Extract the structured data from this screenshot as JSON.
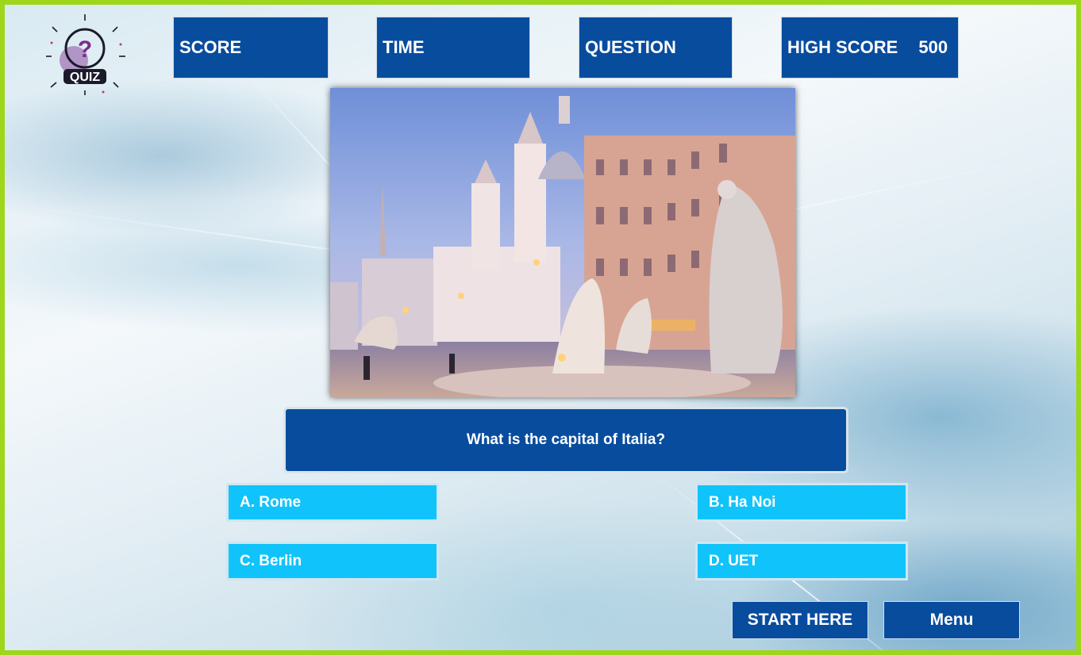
{
  "header": {
    "logo": {
      "icon": "question-mark-icon",
      "label": "QUIZ"
    },
    "stats": [
      {
        "label": "SCORE",
        "value": ""
      },
      {
        "label": "TIME",
        "value": ""
      },
      {
        "label": "QUESTION",
        "value": ""
      },
      {
        "label": "HIGH SCORE",
        "value": "500"
      }
    ]
  },
  "image": {
    "subject": "piazza-navona-rome-photo"
  },
  "question": {
    "text": "What is the capital of Italia?"
  },
  "answers": [
    {
      "label": "A. Rome"
    },
    {
      "label": "B. Ha Noi"
    },
    {
      "label": "C. Berlin"
    },
    {
      "label": "D. UET"
    }
  ],
  "buttons": {
    "start": "START HERE",
    "menu": "Menu"
  },
  "colors": {
    "panel": "#084c9e",
    "answer": "#10c3fb",
    "frame": "#9ed61c"
  }
}
